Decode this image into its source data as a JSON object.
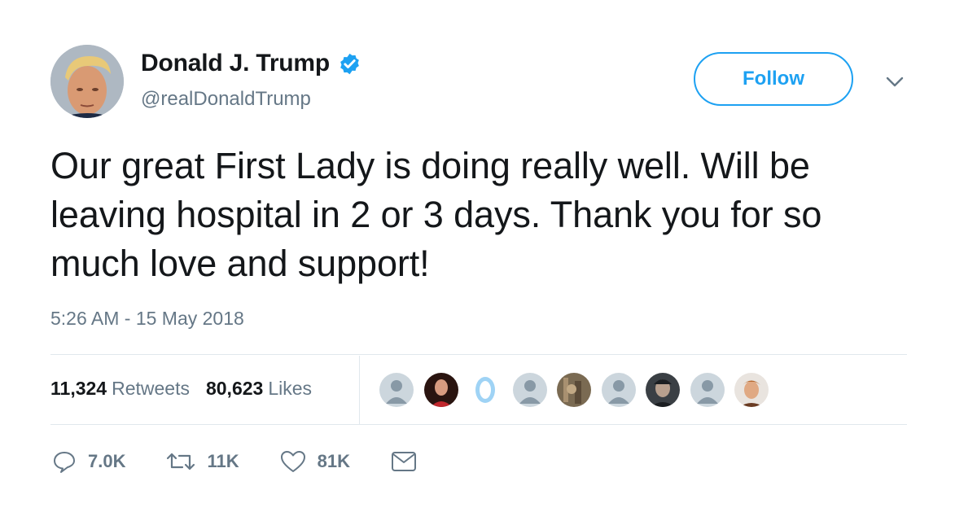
{
  "author": {
    "name": "Donald J. Trump",
    "handle": "@realDonaldTrump",
    "verified": true
  },
  "follow_label": "Follow",
  "tweet": {
    "text": "Our great First Lady is doing really well. Will be leaving hospital in 2 or 3 days. Thank you for so much love and support!",
    "timestamp": "5:26 AM - 15 May 2018"
  },
  "stats": {
    "retweets_count": "11,324",
    "retweets_label": "Retweets",
    "likes_count": "80,623",
    "likes_label": "Likes"
  },
  "actions": {
    "replies": "7.0K",
    "retweets": "11K",
    "likes": "81K"
  },
  "colors": {
    "accent": "#1da1f2",
    "secondary_text": "#657786",
    "divider": "#e1e8ed"
  },
  "icons": [
    "verified-badge-icon",
    "chevron-down-icon",
    "reply-icon",
    "retweet-icon",
    "heart-icon",
    "message-icon"
  ]
}
